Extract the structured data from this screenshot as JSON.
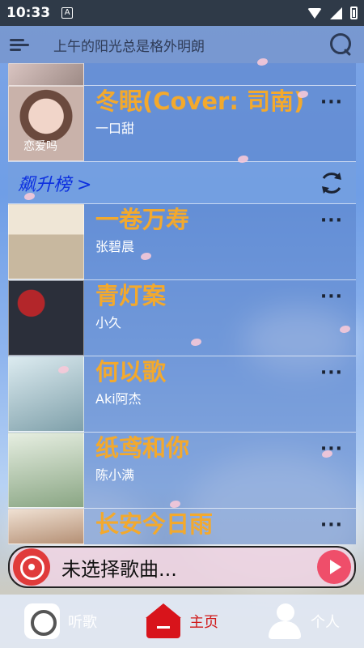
{
  "status_bar": {
    "time": "10:33",
    "notification_badge": "A"
  },
  "search": {
    "placeholder": "上午的阳光总是格外明朗"
  },
  "songs_top": [
    {
      "title": "冬眠(Cover: 司南)",
      "artist": "一口甜",
      "cover_caption": "恋爱吗",
      "cover_colors": [
        "#c9b2aa",
        "#8f6d66"
      ]
    }
  ],
  "rising_chart": {
    "heading": "飙升榜 >",
    "songs": [
      {
        "title": "一卷万寿",
        "artist": "张碧晨",
        "cover_colors": [
          "#e9dfcf",
          "#b9a88e"
        ]
      },
      {
        "title": "青灯案",
        "artist": "小久",
        "cover_colors": [
          "#2b2f3a",
          "#b3262a"
        ]
      },
      {
        "title": "何以歌",
        "artist": "Aki阿杰",
        "cover_colors": [
          "#cfe3ea",
          "#5f7f8a"
        ]
      },
      {
        "title": "纸鸢和你",
        "artist": "陈小满",
        "cover_colors": [
          "#dfe8d9",
          "#7e9a78"
        ]
      },
      {
        "title": "长安今日雨",
        "artist": "",
        "cover_colors": [
          "#e8d6c6",
          "#a07f68"
        ]
      }
    ]
  },
  "player": {
    "now_playing": "未选择歌曲..."
  },
  "tabs": [
    {
      "label": "听歌",
      "icon": "music-app-icon",
      "active": false
    },
    {
      "label": "主页",
      "icon": "home-icon",
      "active": true
    },
    {
      "label": "个人",
      "icon": "person-icon",
      "active": false
    }
  ],
  "more_label": "···",
  "colors": {
    "title": "#f3a92d",
    "accent_red": "#d01919",
    "section_blue": "#0c2fe0"
  }
}
